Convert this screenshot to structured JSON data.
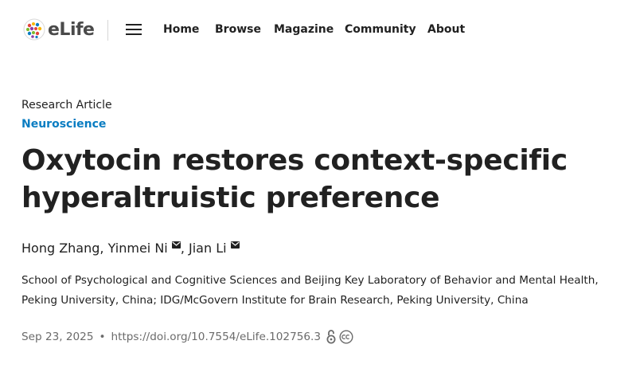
{
  "header": {
    "logo_text": "eLife",
    "nav": [
      "Home",
      "Browse",
      "Magazine",
      "Community",
      "About"
    ]
  },
  "article": {
    "type": "Research Article",
    "subject": "Neuroscience",
    "title_line1": "Oxytocin restores context-specific",
    "title_line2": "hyperaltruistic preference",
    "authors": [
      "Hong Zhang",
      "Yinmei Ni",
      "Jian Li"
    ],
    "author_separator": ", ",
    "affiliation": "School of Psychological and Cognitive Sciences and Beijing Key Laboratory of Behavior and Mental Health, Peking University, China; IDG/McGovern Institute for Brain Research, Peking University, China",
    "date": "Sep 23, 2025",
    "bullet": "•",
    "doi": "https://doi.org/10.7554/eLife.102756.3"
  },
  "colors": {
    "text": "#212121",
    "subject_link": "#0a7dc2",
    "meta_text": "#6b6b6b"
  },
  "icons": [
    "elife-logo-icon",
    "menu-icon",
    "mail-icon",
    "open-access-icon",
    "creative-commons-icon"
  ]
}
